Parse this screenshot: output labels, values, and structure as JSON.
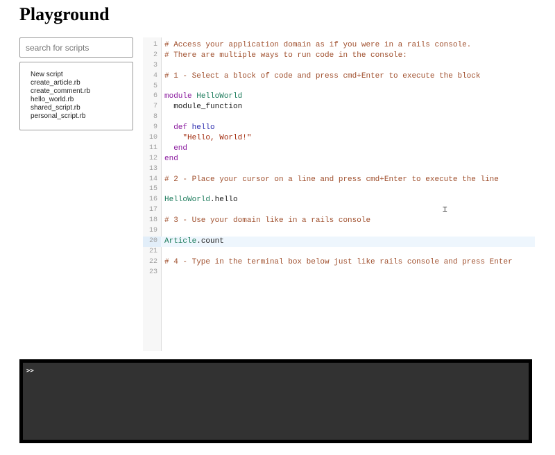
{
  "header": {
    "title": "Playground"
  },
  "sidebar": {
    "search": {
      "placeholder": "search for scripts",
      "value": ""
    },
    "scripts": [
      "New script",
      "create_article.rb",
      "create_comment.rb",
      "hello_world.rb",
      "shared_script.rb",
      "personal_script.rb"
    ]
  },
  "editor": {
    "active_line": 20,
    "lines": [
      {
        "n": "1",
        "tokens": [
          {
            "t": "# Access your application domain as if you were in a rails console.",
            "k": "comment"
          }
        ]
      },
      {
        "n": "2",
        "tokens": [
          {
            "t": "# There are multiple ways to run code in the console:",
            "k": "comment"
          }
        ]
      },
      {
        "n": "3",
        "tokens": []
      },
      {
        "n": "4",
        "tokens": [
          {
            "t": "# 1 - Select a block of code and press cmd+Enter to execute the block",
            "k": "comment"
          }
        ]
      },
      {
        "n": "5",
        "tokens": []
      },
      {
        "n": "6",
        "tokens": [
          {
            "t": "module",
            "k": "keyword"
          },
          {
            "t": " ",
            "k": "plain"
          },
          {
            "t": "HelloWorld",
            "k": "const"
          }
        ]
      },
      {
        "n": "7",
        "tokens": [
          {
            "t": "  module_function",
            "k": "plain"
          }
        ]
      },
      {
        "n": "8",
        "tokens": []
      },
      {
        "n": "9",
        "tokens": [
          {
            "t": "  ",
            "k": "plain"
          },
          {
            "t": "def",
            "k": "keyword"
          },
          {
            "t": " ",
            "k": "plain"
          },
          {
            "t": "hello",
            "k": "keyword2"
          }
        ]
      },
      {
        "n": "10",
        "tokens": [
          {
            "t": "    ",
            "k": "plain"
          },
          {
            "t": "\"Hello, World!\"",
            "k": "string"
          }
        ]
      },
      {
        "n": "11",
        "tokens": [
          {
            "t": "  ",
            "k": "plain"
          },
          {
            "t": "end",
            "k": "keyword"
          }
        ]
      },
      {
        "n": "12",
        "tokens": [
          {
            "t": "end",
            "k": "keyword"
          }
        ]
      },
      {
        "n": "13",
        "tokens": []
      },
      {
        "n": "14",
        "tokens": [
          {
            "t": "# 2 - Place your cursor on a line and press cmd+Enter to execute the line",
            "k": "comment"
          }
        ]
      },
      {
        "n": "15",
        "tokens": []
      },
      {
        "n": "16",
        "tokens": [
          {
            "t": "HelloWorld",
            "k": "const"
          },
          {
            "t": ".hello",
            "k": "plain"
          }
        ]
      },
      {
        "n": "17",
        "tokens": []
      },
      {
        "n": "18",
        "tokens": [
          {
            "t": "# 3 - Use your domain like in a rails console",
            "k": "comment"
          }
        ]
      },
      {
        "n": "19",
        "tokens": []
      },
      {
        "n": "20",
        "tokens": [
          {
            "t": "Article",
            "k": "const"
          },
          {
            "t": ".count",
            "k": "plain"
          }
        ]
      },
      {
        "n": "21",
        "tokens": []
      },
      {
        "n": "22",
        "tokens": [
          {
            "t": "# 4 - Type in the terminal box below just like rails console and press Enter",
            "k": "comment"
          }
        ]
      },
      {
        "n": "23",
        "tokens": []
      }
    ]
  },
  "terminal": {
    "prompt": ">>",
    "value": ""
  },
  "colors": {
    "comment": "#a0502e",
    "keyword": "#8a1a9e",
    "method": "#2a2aad",
    "constant": "#1a7a5a",
    "string": "#a0280a",
    "terminal_bg": "#323232"
  }
}
